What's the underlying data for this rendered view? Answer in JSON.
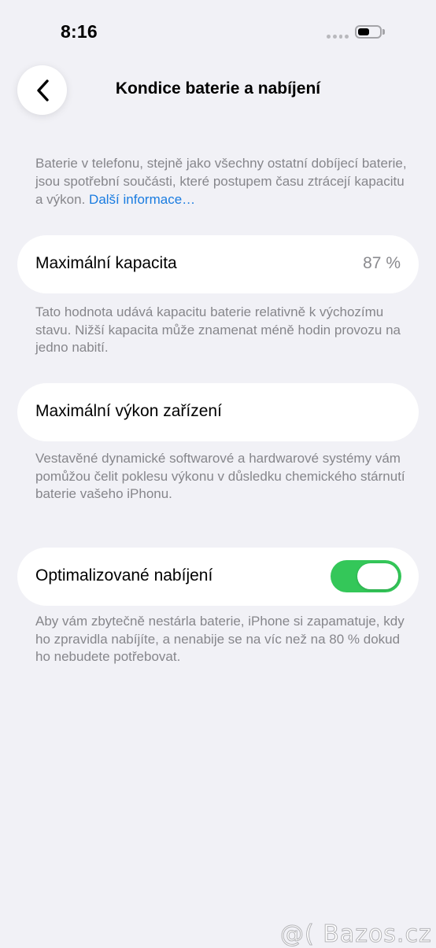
{
  "status": {
    "time": "8:16",
    "battery_level": 0.55
  },
  "nav": {
    "back_icon": "chevron-left-icon",
    "title": "Kondice baterie a nabíjení"
  },
  "intro": {
    "text": "Baterie v telefonu, stejně jako všechny ostatní dobíjecí baterie, jsou spotřební součásti, které postupem času ztrácejí kapacitu a výkon. ",
    "link": "Další informace…"
  },
  "max_capacity": {
    "label": "Maximální kapacita",
    "value": "87 %",
    "footnote": "Tato hodnota udává kapacitu baterie relativně k výchozímu stavu. Nižší kapacita může znamenat méně hodin provozu na jedno nabití."
  },
  "peak_performance": {
    "label": "Maximální výkon zařízení",
    "footnote": "Vestavěné dynamické softwarové a hardwarové systémy vám pomůžou čelit poklesu výkonu v důsledku chemického stárnutí baterie vašeho iPhonu."
  },
  "optimized_charging": {
    "label": "Optimalizované nabíjení",
    "enabled": true,
    "toggle_color": "#34c759",
    "footnote": "Aby vám zbytečně nestárla baterie, iPhone si zapamatuje, kdy ho zpravidla nabíjíte, a nenabije se na víc než na 80 % dokud ho nebudete potřebovat."
  },
  "colors": {
    "background": "#f1f1f6",
    "link": "#1a7ce0",
    "secondary_text": "#86868b"
  },
  "watermark": {
    "text": "@( Bazos.cz"
  }
}
